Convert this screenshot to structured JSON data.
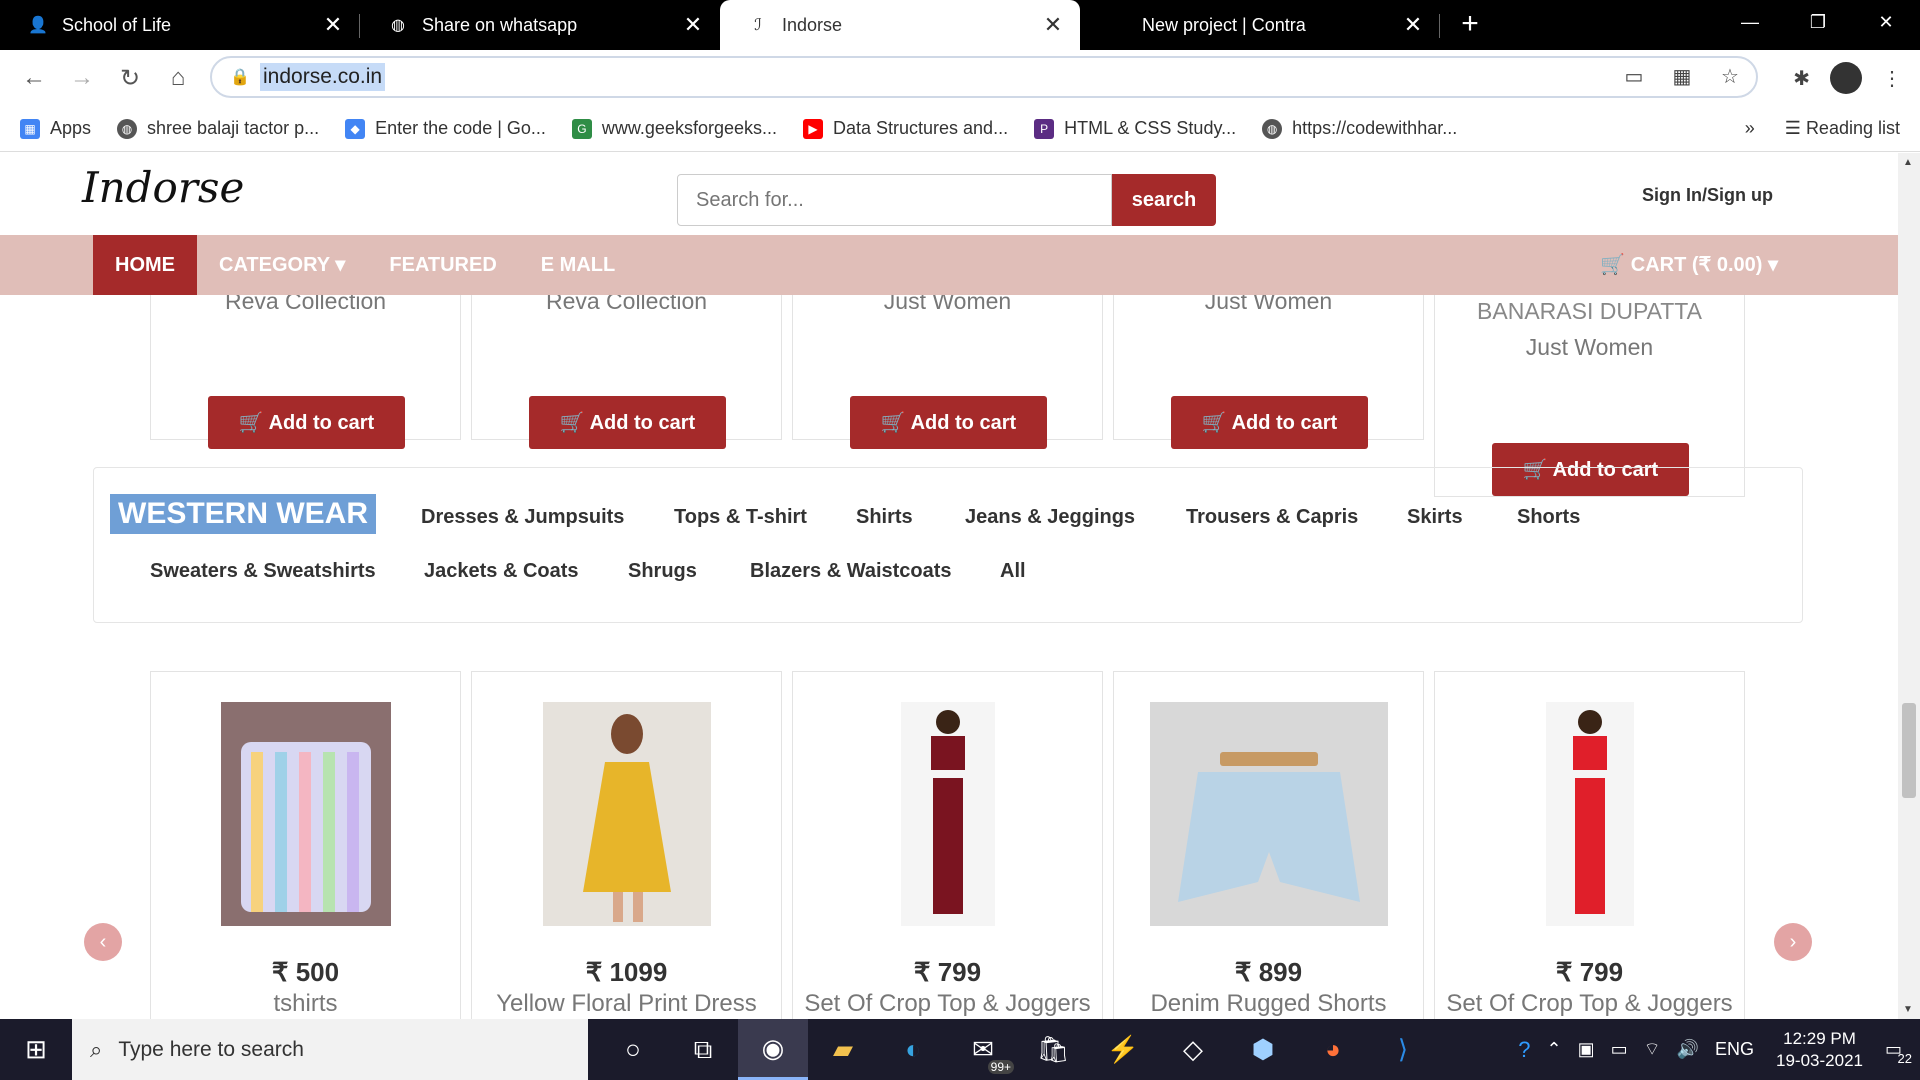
{
  "browser": {
    "tabs": [
      {
        "title": "School of Life",
        "icon": "person-icon",
        "active": false
      },
      {
        "title": "Share on whatsapp",
        "icon": "globe-icon",
        "active": false
      },
      {
        "title": "Indorse",
        "icon": "indorse-icon",
        "active": true
      },
      {
        "title": "New project | Contra",
        "icon": "contra-icon",
        "active": false
      }
    ],
    "new_tab": "+",
    "window_controls": {
      "minimize": "—",
      "restore": "❐",
      "close": "✕"
    },
    "url": "indorse.co.in",
    "bookmarks": [
      {
        "label": "Apps",
        "icon": "apps-grid-icon",
        "color": "#4285f4"
      },
      {
        "label": "shree balaji tactor p...",
        "icon": "globe-icon",
        "color": "#555555"
      },
      {
        "label": "Enter the code | Go...",
        "icon": "google-classroom-icon",
        "color": "#4285f4"
      },
      {
        "label": "www.geeksforgeeks...",
        "icon": "geeksforgeeks-icon",
        "color": "#2f8d46"
      },
      {
        "label": "Data Structures and...",
        "icon": "youtube-icon",
        "color": "#ff0000"
      },
      {
        "label": "HTML & CSS Study...",
        "icon": "p-icon",
        "color": "#5b2c83"
      },
      {
        "label": "https://codewithhar...",
        "icon": "globe-icon",
        "color": "#555555"
      }
    ],
    "bookmarks_more": "»",
    "reading_list": "Reading list"
  },
  "site": {
    "logo": "Indorse",
    "search_placeholder": "Search for...",
    "search_button": "search",
    "signin": "Sign In/Sign up",
    "nav": {
      "home": "HOME",
      "category": "CATEGORY ▾",
      "featured": "FEATURED",
      "emall": "E MALL",
      "cart": "🛒 CART (₹ 0.00) ▾"
    },
    "accent": "#a52a2a",
    "nav_bg": "#e0beb8"
  },
  "top_row": [
    {
      "brand": "Reva Collection",
      "button": "🛒 Add to cart"
    },
    {
      "brand": "Reva Collection",
      "button": "🛒 Add to cart"
    },
    {
      "brand": "Just Women",
      "button": "🛒 Add to cart"
    },
    {
      "brand": "Just Women",
      "button": "🛒 Add to cart"
    },
    {
      "name": "BANARASI DUPATTA",
      "brand": "Just Women",
      "button": "🛒 Add to cart"
    }
  ],
  "category": {
    "heading": "WESTERN WEAR",
    "links_row1": [
      "Dresses & Jumpsuits",
      "Tops & T-shirt",
      "Shirts",
      "Jeans & Jeggings",
      "Trousers & Capris",
      "Skirts",
      "Shorts"
    ],
    "links_row2": [
      "Sweaters & Sweatshirts",
      "Jackets & Coats",
      "Shrugs",
      "Blazers & Waistcoats",
      "All"
    ]
  },
  "products": [
    {
      "price": "₹ 500",
      "name": "tshirts"
    },
    {
      "price": "₹ 1099",
      "name": "Yellow Floral Print Dress"
    },
    {
      "price": "₹ 799",
      "name": "Set Of Crop Top & Joggers"
    },
    {
      "price": "₹ 899",
      "name": "Denim Rugged Shorts"
    },
    {
      "price": "₹ 799",
      "name": "Set Of Crop Top & Joggers"
    }
  ],
  "carousel": {
    "prev": "‹",
    "next": "›"
  },
  "taskbar": {
    "search_placeholder": "Type here to search",
    "mail_badge": "99+",
    "language": "ENG",
    "time": "12:29 PM",
    "date": "19-03-2021",
    "notifications": "22"
  }
}
